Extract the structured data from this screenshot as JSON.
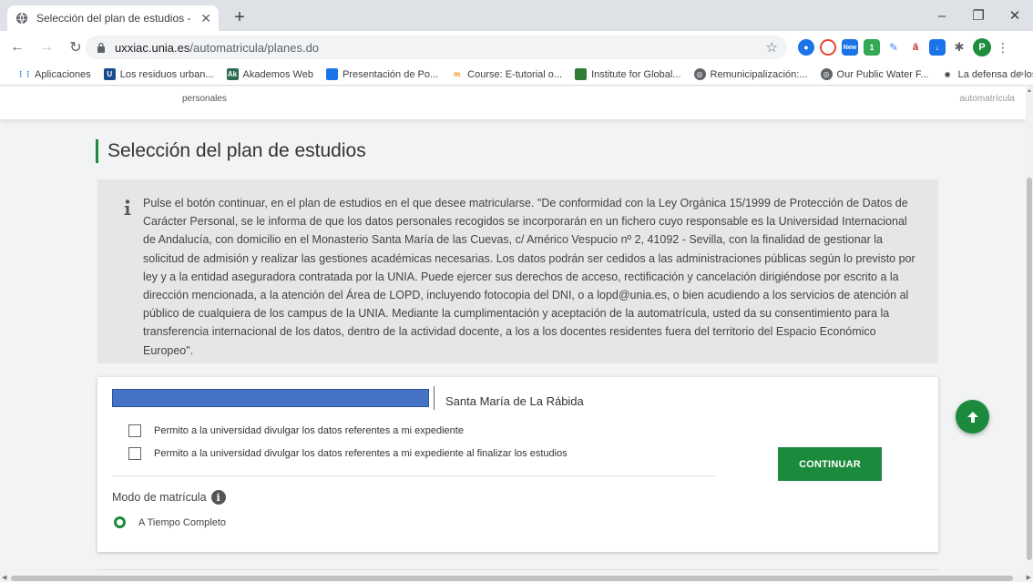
{
  "browser": {
    "tab_title": "Selección del plan de estudios - ",
    "url_domain": "uxxiac.unia.es",
    "url_path": "/automatricula/planes.do",
    "profile_initial": "P",
    "ext_badge": "New",
    "ext_count": "1",
    "bookmarks": [
      {
        "label": "Aplicaciones",
        "icon": "apps-grid-icon"
      },
      {
        "label": "Los residuos urban...",
        "icon": "u-icon"
      },
      {
        "label": "Akademos Web",
        "icon": "ak-icon"
      },
      {
        "label": "Presentación de Po...",
        "icon": "flag-icon"
      },
      {
        "label": "Course: E-tutorial o...",
        "icon": "moodle-icon"
      },
      {
        "label": "Institute for Global...",
        "icon": "green-bookmark-icon"
      },
      {
        "label": "Remunicipalización:...",
        "icon": "globe-icon"
      },
      {
        "label": "Our Public Water F...",
        "icon": "globe-icon"
      },
      {
        "label": "La defensa de los s...",
        "icon": "broadcast-icon"
      }
    ]
  },
  "page": {
    "topstrip_left": "personales",
    "topstrip_right": "automatrícula",
    "title": "Selección del plan de estudios",
    "info_text": "Pulse el botón continuar, en el plan de estudios en el que desee matricularse. \"De conformidad con la Ley Orgánica 15/1999 de Protección de Datos de Carácter Personal, se le informa de que los datos personales recogidos se incorporarán en un fichero cuyo responsable es la Universidad Internacional de Andalucía, con domicilio en el Monasterio Santa María de las Cuevas, c/ Américo Vespucio nº 2, 41092 - Sevilla, con la finalidad de gestionar la solicitud de admisión y realizar las gestiones académicas necesarias. Los datos podrán ser cedidos a las administraciones públicas según lo previsto por ley y a la entidad aseguradora contratada por la UNIA. Puede ejercer sus derechos de acceso, rectificación y cancelación dirigiéndose por escrito a la dirección mencionada, a la atención del Área de LOPD, incluyendo fotocopia del DNI, o a lopd@unia.es, o bien acudiendo a los servicios de atención al público de cualquiera de los campus de la UNIA. Mediante la cumplimentación y aceptación de la automatrícula, usted da su consentimiento para la transferencia internacional de los datos, dentro de la actividad docente, a los a los docentes residentes fuera del territorio del Espacio Económico Europeo\".",
    "plan": {
      "campus": "Santa María de La Rábida",
      "checkbox1_label": "Permito a la universidad divulgar los datos referentes a mi expediente",
      "checkbox2_label": "Permito a la universidad divulgar los datos referentes a mi expediente al finalizar los estudios",
      "continue_label": "CONTINUAR",
      "modo_label": "Modo de matrícula",
      "modo_option": "A Tiempo Completo"
    }
  },
  "colors": {
    "accent_green": "#1c8a3c",
    "redaction_blue": "#4472c4",
    "info_bg": "#e5e6e7"
  }
}
